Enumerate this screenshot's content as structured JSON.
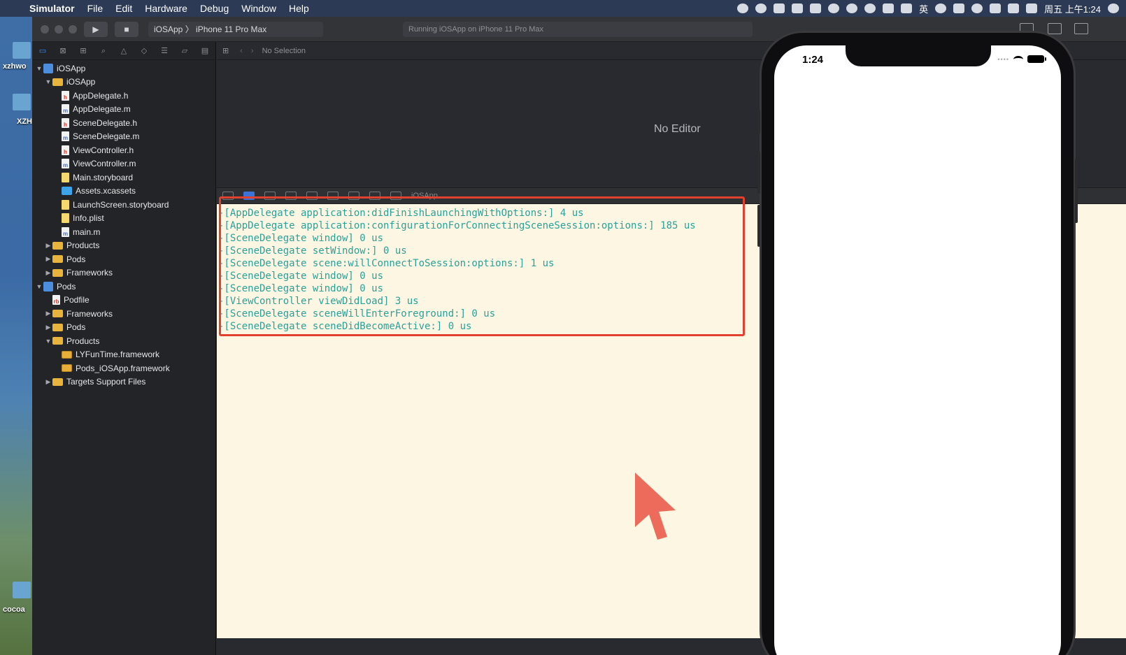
{
  "menubar": {
    "app_name": "Simulator",
    "items": [
      "File",
      "Edit",
      "Hardware",
      "Debug",
      "Window",
      "Help"
    ],
    "clock": "周五 上午1:24",
    "input_method": "英"
  },
  "desktop": {
    "labels": [
      "xzhwo",
      "XZH",
      "cocoa"
    ]
  },
  "toolbar": {
    "scheme_app": "iOSApp",
    "scheme_device": "iPhone 11 Pro Max",
    "activity": "Running iOSApp on iPhone 11 Pro Max"
  },
  "jumpbar": {
    "selection": "No Selection"
  },
  "editor": {
    "placeholder": "No Editor"
  },
  "debugbar": {
    "target": "iOSApp"
  },
  "navigator": {
    "items": [
      {
        "label": "iOSApp",
        "level": 0,
        "disclosure": "▼",
        "icon": "proj"
      },
      {
        "label": "iOSApp",
        "level": 1,
        "disclosure": "▼",
        "icon": "folder"
      },
      {
        "label": "AppDelegate.h",
        "level": 2,
        "disclosure": "",
        "icon": "doc-h"
      },
      {
        "label": "AppDelegate.m",
        "level": 2,
        "disclosure": "",
        "icon": "doc-m"
      },
      {
        "label": "SceneDelegate.h",
        "level": 2,
        "disclosure": "",
        "icon": "doc-h"
      },
      {
        "label": "SceneDelegate.m",
        "level": 2,
        "disclosure": "",
        "icon": "doc-m"
      },
      {
        "label": "ViewController.h",
        "level": 2,
        "disclosure": "",
        "icon": "doc-h"
      },
      {
        "label": "ViewController.m",
        "level": 2,
        "disclosure": "",
        "icon": "doc-m"
      },
      {
        "label": "Main.storyboard",
        "level": 2,
        "disclosure": "",
        "icon": "story"
      },
      {
        "label": "Assets.xcassets",
        "level": 2,
        "disclosure": "",
        "icon": "assets"
      },
      {
        "label": "LaunchScreen.storyboard",
        "level": 2,
        "disclosure": "",
        "icon": "story"
      },
      {
        "label": "Info.plist",
        "level": 2,
        "disclosure": "",
        "icon": "story"
      },
      {
        "label": "main.m",
        "level": 2,
        "disclosure": "",
        "icon": "doc-m"
      },
      {
        "label": "Products",
        "level": 1,
        "disclosure": "▶",
        "icon": "folder"
      },
      {
        "label": "Pods",
        "level": 1,
        "disclosure": "▶",
        "icon": "folder"
      },
      {
        "label": "Frameworks",
        "level": 1,
        "disclosure": "▶",
        "icon": "folder"
      },
      {
        "label": "Pods",
        "level": 0,
        "disclosure": "▼",
        "icon": "proj"
      },
      {
        "label": "Podfile",
        "level": 1,
        "disclosure": "",
        "icon": "pod"
      },
      {
        "label": "Frameworks",
        "level": 1,
        "disclosure": "▶",
        "icon": "folder"
      },
      {
        "label": "Pods",
        "level": 1,
        "disclosure": "▶",
        "icon": "folder"
      },
      {
        "label": "Products",
        "level": 1,
        "disclosure": "▼",
        "icon": "folder"
      },
      {
        "label": "LYFunTime.framework",
        "level": 2,
        "disclosure": "",
        "icon": "fw"
      },
      {
        "label": "Pods_iOSApp.framework",
        "level": 2,
        "disclosure": "",
        "icon": "fw"
      },
      {
        "label": "Targets Support Files",
        "level": 1,
        "disclosure": "▶",
        "icon": "folder"
      }
    ]
  },
  "console": {
    "lines": [
      "-[AppDelegate application:didFinishLaunchingWithOptions:] 4 us",
      "-[AppDelegate application:configurationForConnectingSceneSession:options:] 185 us",
      "-[SceneDelegate window] 0 us",
      "-[SceneDelegate setWindow:] 0 us",
      "-[SceneDelegate scene:willConnectToSession:options:] 1 us",
      "-[SceneDelegate window] 0 us",
      "-[SceneDelegate window] 0 us",
      "-[ViewController viewDidLoad] 3 us",
      "-[SceneDelegate sceneWillEnterForeground:] 0 us",
      "-[SceneDelegate sceneDidBecomeActive:] 0 us"
    ]
  },
  "simulator": {
    "time": "1:24"
  },
  "colors": {
    "console_bg": "#fdf6e3",
    "console_text": "#2aa198",
    "highlight": "#e2412f",
    "cursor_annotation": "#ec6b5a"
  }
}
